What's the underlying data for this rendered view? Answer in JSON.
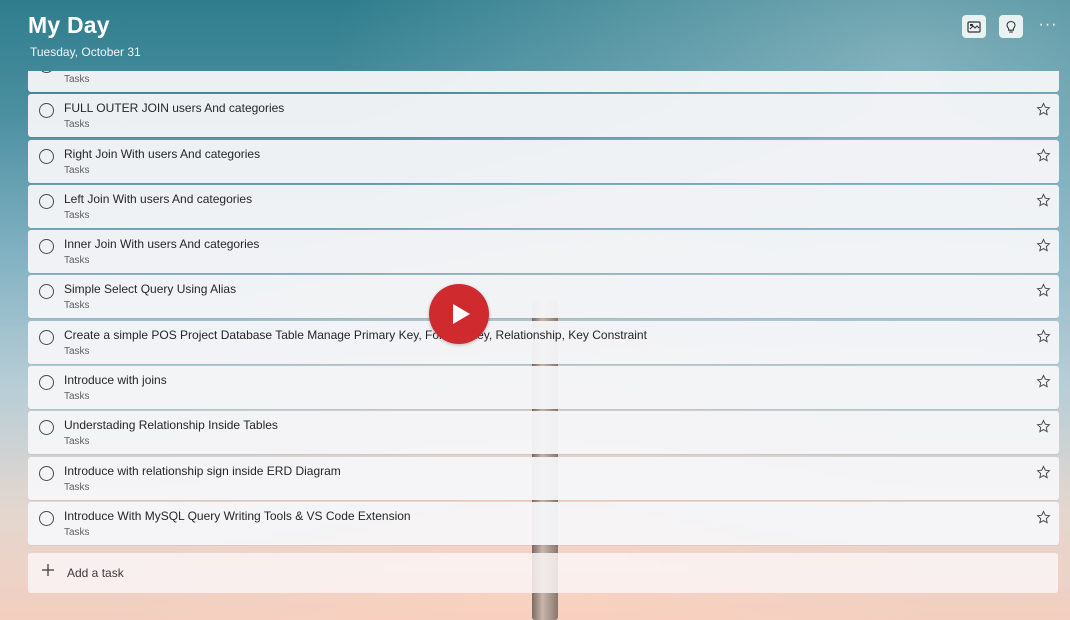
{
  "header": {
    "title": "My Day",
    "date": "Tuesday, October 31"
  },
  "toolbar": {
    "buttons": [
      {
        "name": "background-icon"
      },
      {
        "name": "suggestions-icon"
      }
    ],
    "more_label": "···"
  },
  "tasks": [
    {
      "title": "",
      "list": "Tasks"
    },
    {
      "title": "FULL OUTER JOIN users And categories",
      "list": "Tasks"
    },
    {
      "title": "Right Join With users And categories",
      "list": "Tasks"
    },
    {
      "title": "Left Join With users And categories",
      "list": "Tasks"
    },
    {
      "title": "Inner Join With users And categories",
      "list": "Tasks"
    },
    {
      "title": "Simple Select Query Using Alias",
      "list": "Tasks"
    },
    {
      "title": "Create a simple POS Project Database Table Manage Primary Key, Foreign Key, Relationship, Key Constraint",
      "list": "Tasks"
    },
    {
      "title": "Introduce with joins",
      "list": "Tasks"
    },
    {
      "title": "Understading Relationship Inside Tables",
      "list": "Tasks"
    },
    {
      "title": "Introduce with relationship sign inside ERD Diagram",
      "list": "Tasks"
    },
    {
      "title": "Introduce With MySQL Query Writing Tools & VS Code Extension",
      "list": "Tasks"
    }
  ],
  "add_task": {
    "label": "Add a task"
  },
  "video_overlay": {
    "icon": "play-icon",
    "color": "#cf2b2f"
  }
}
